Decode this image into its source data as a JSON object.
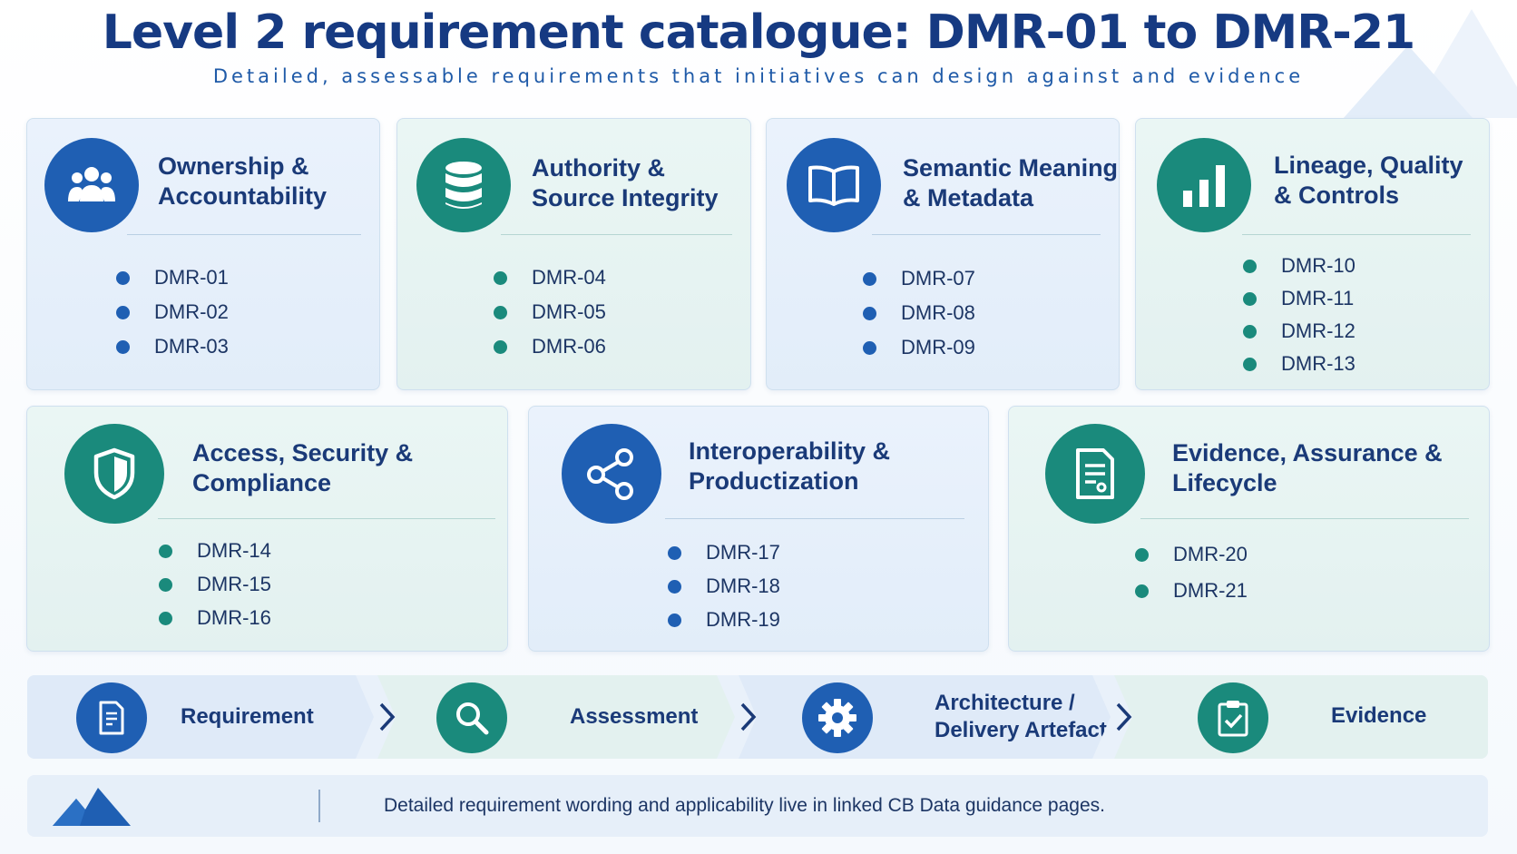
{
  "header": {
    "title": "Level 2 requirement catalogue: DMR-01 to DMR-21",
    "subtitle": "Detailed, assessable requirements that initiatives can design against and evidence"
  },
  "colors": {
    "blue": "#1f5fb3",
    "teal": "#1a8a7c",
    "title": "#163a82"
  },
  "categories": [
    {
      "title": "Ownership & Accountability",
      "title_lines": [
        "Ownership &",
        "Accountability"
      ],
      "icon": "people-icon",
      "accent": "blue",
      "items": [
        "DMR-01",
        "DMR-02",
        "DMR-03"
      ]
    },
    {
      "title": "Authority & Source Integrity",
      "title_lines": [
        "Authority &",
        "Source Integrity"
      ],
      "icon": "database-icon",
      "accent": "teal",
      "items": [
        "DMR-04",
        "DMR-05",
        "DMR-06"
      ]
    },
    {
      "title": "Semantic Meaning & Metadata",
      "title_lines": [
        "Semantic Meaning",
        "& Metadata"
      ],
      "icon": "book-icon",
      "accent": "blue",
      "items": [
        "DMR-07",
        "DMR-08",
        "DMR-09"
      ]
    },
    {
      "title": "Lineage, Quality & Controls",
      "title_lines": [
        "Lineage, Quality",
        "& Controls"
      ],
      "icon": "bar-chart-icon",
      "accent": "teal",
      "items": [
        "DMR-10",
        "DMR-11",
        "DMR-12",
        "DMR-13"
      ]
    },
    {
      "title": "Access, Security & Compliance",
      "title_lines": [
        "Access, Security &",
        "Compliance"
      ],
      "icon": "shield-icon",
      "accent": "teal",
      "items": [
        "DMR-14",
        "DMR-15",
        "DMR-16"
      ]
    },
    {
      "title": "Interoperability & Productization",
      "title_lines": [
        "Interoperability &",
        "Productization"
      ],
      "icon": "share-icon",
      "accent": "blue",
      "items": [
        "DMR-17",
        "DMR-18",
        "DMR-19"
      ]
    },
    {
      "title": "Evidence, Assurance & Lifecycle",
      "title_lines": [
        "Evidence, Assurance &",
        "Lifecycle"
      ],
      "icon": "document-icon",
      "accent": "teal",
      "items": [
        "DMR-20",
        "DMR-21"
      ]
    }
  ],
  "flow": [
    {
      "label": "Requirement",
      "label_lines": [
        "Requirement"
      ],
      "icon": "document-icon",
      "accent": "blue"
    },
    {
      "label": "Assessment",
      "label_lines": [
        "Assessment"
      ],
      "icon": "search-icon",
      "accent": "teal"
    },
    {
      "label": "Architecture / Delivery Artefact",
      "label_lines": [
        "Architecture /",
        "Delivery Artefact"
      ],
      "icon": "gear-icon",
      "accent": "blue"
    },
    {
      "label": "Evidence",
      "label_lines": [
        "Evidence"
      ],
      "icon": "clipboard-check-icon",
      "accent": "teal"
    }
  ],
  "footer": {
    "note": "Detailed requirement wording and applicability live in linked CB Data guidance pages.",
    "logo": "mountain-logo"
  }
}
